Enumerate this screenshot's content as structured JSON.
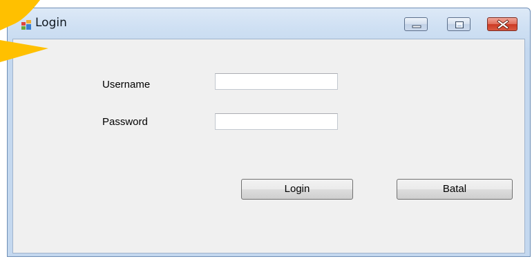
{
  "window": {
    "title": "Login",
    "icon": "form-icon",
    "controls": {
      "minimize_icon": "minimize-icon",
      "maximize_icon": "maximize-icon",
      "close_icon": "close-icon"
    }
  },
  "form": {
    "username": {
      "label": "Username",
      "value": "",
      "placeholder": ""
    },
    "password": {
      "label": "Password",
      "value": "",
      "placeholder": ""
    },
    "buttons": {
      "login_label": "Login",
      "cancel_label": "Batal"
    }
  },
  "colors": {
    "watermark": "#ffc000",
    "close_button": "#cc3a24",
    "titlebar": "#c4d8ef",
    "client_background": "#f0f0f0"
  }
}
